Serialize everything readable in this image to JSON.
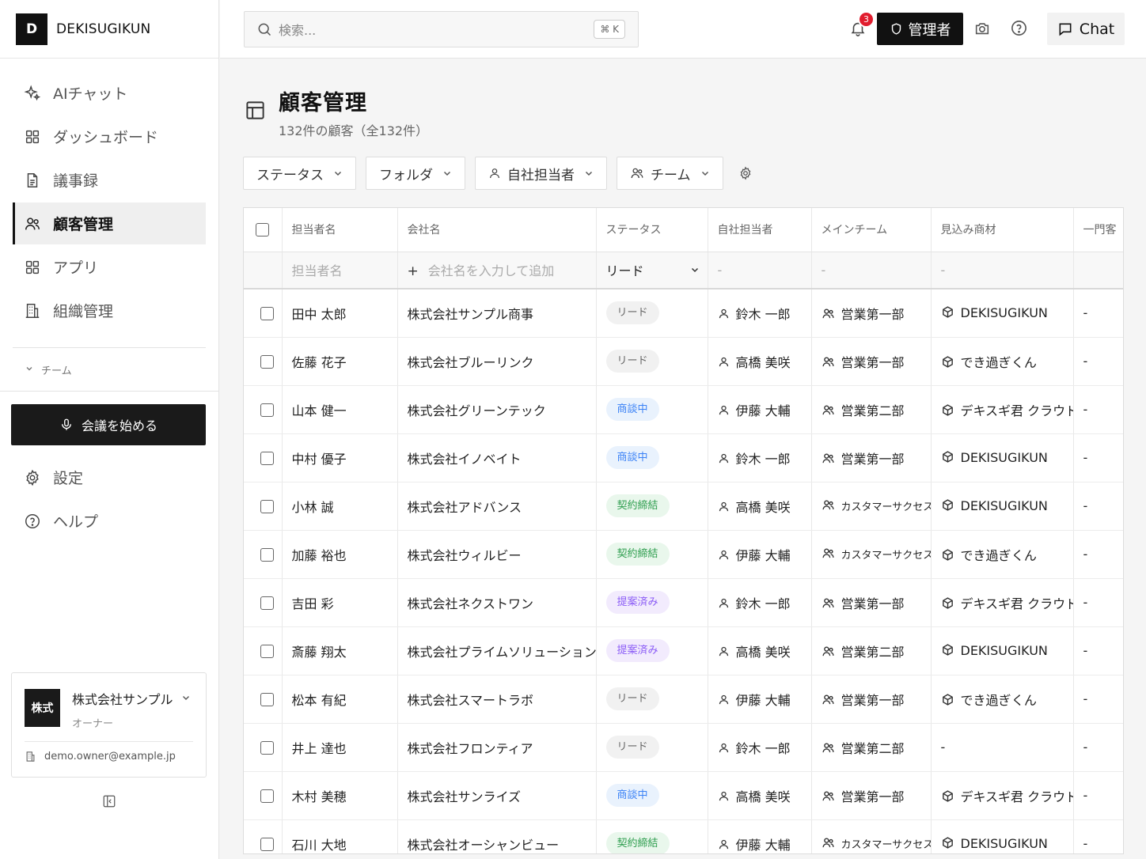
{
  "brand": {
    "logo_letter": "D",
    "name": "DEKISUGIKUN"
  },
  "nav": [
    {
      "label": "AIチャット",
      "icon": "sparkles-icon",
      "active": false
    },
    {
      "label": "ダッシュボード",
      "icon": "grid-icon",
      "active": false
    },
    {
      "label": "議事録",
      "icon": "document-icon",
      "active": false
    },
    {
      "label": "顧客管理",
      "icon": "users-icon",
      "active": true
    },
    {
      "label": "アプリ",
      "icon": "grid-icon",
      "active": false
    },
    {
      "label": "組織管理",
      "icon": "building-icon",
      "active": false
    }
  ],
  "team_section": {
    "label": "チーム"
  },
  "meeting_button": {
    "label": "会議を始める"
  },
  "nav_bottom": [
    {
      "label": "設定",
      "icon": "gear-icon"
    },
    {
      "label": "ヘルプ",
      "icon": "help-circle-icon"
    }
  ],
  "org": {
    "logo_text": "株式",
    "name": "株式会社サンプル",
    "role": "オーナー",
    "email": "demo.owner@example.jp"
  },
  "topbar": {
    "search_placeholder": "検索...",
    "shortcut": "⌘ K",
    "notification_count": "3",
    "admin_label": "管理者",
    "chat_label": "Chat"
  },
  "page": {
    "title": "顧客管理",
    "subtitle": "132件の顧客（全132件）"
  },
  "filters": [
    {
      "label": "ステータス",
      "icon": ""
    },
    {
      "label": "フォルダ",
      "icon": ""
    },
    {
      "label": "自社担当者",
      "icon": "user-icon"
    },
    {
      "label": "チーム",
      "icon": "users-icon"
    }
  ],
  "table": {
    "columns": [
      "担当者名",
      "会社名",
      "ステータス",
      "自社担当者",
      "メインチーム",
      "見込み商材",
      "一門客"
    ],
    "add_row": {
      "name_placeholder": "担当者名",
      "company_placeholder": "会社名を入力して追加",
      "status_value": "リード",
      "owner": "-",
      "team": "-",
      "product": "-"
    },
    "rows": [
      {
        "name": "田中 太郎",
        "company": "株式会社サンプル商事",
        "status": "リード",
        "status_type": "lead",
        "owner": "鈴木 一郎",
        "team": "営業第一部",
        "product": "DEKISUGIKUN",
        "extra": "-"
      },
      {
        "name": "佐藤 花子",
        "company": "株式会社ブルーリンク",
        "status": "リード",
        "status_type": "lead",
        "owner": "高橋 美咲",
        "team": "営業第一部",
        "product": "でき過ぎくん",
        "extra": "-"
      },
      {
        "name": "山本 健一",
        "company": "株式会社グリーンテック",
        "status": "商談中",
        "status_type": "nego",
        "owner": "伊藤 大輔",
        "team": "営業第二部",
        "product": "デキスギ君 クラウド",
        "extra": "-"
      },
      {
        "name": "中村 優子",
        "company": "株式会社イノベイト",
        "status": "商談中",
        "status_type": "nego",
        "owner": "鈴木 一郎",
        "team": "営業第一部",
        "product": "DEKISUGIKUN",
        "extra": "-"
      },
      {
        "name": "小林 誠",
        "company": "株式会社アドバンス",
        "status": "契約締結",
        "status_type": "won",
        "owner": "高橋 美咲",
        "team": "カスタマーサクセス",
        "product": "DEKISUGIKUN",
        "extra": "-"
      },
      {
        "name": "加藤 裕也",
        "company": "株式会社ウィルビー",
        "status": "契約締結",
        "status_type": "won",
        "owner": "伊藤 大輔",
        "team": "カスタマーサクセス",
        "product": "でき過ぎくん",
        "extra": "-"
      },
      {
        "name": "吉田 彩",
        "company": "株式会社ネクストワン",
        "status": "提案済み",
        "status_type": "prop",
        "owner": "鈴木 一郎",
        "team": "営業第一部",
        "product": "デキスギ君 クラウド",
        "extra": "-"
      },
      {
        "name": "斎藤 翔太",
        "company": "株式会社プライムソリューション",
        "status": "提案済み",
        "status_type": "prop",
        "owner": "高橋 美咲",
        "team": "営業第二部",
        "product": "DEKISUGIKUN",
        "extra": "-"
      },
      {
        "name": "松本 有紀",
        "company": "株式会社スマートラボ",
        "status": "リード",
        "status_type": "lead",
        "owner": "伊藤 大輔",
        "team": "営業第一部",
        "product": "でき過ぎくん",
        "extra": "-"
      },
      {
        "name": "井上 達也",
        "company": "株式会社フロンティア",
        "status": "リード",
        "status_type": "lead",
        "owner": "鈴木 一郎",
        "team": "営業第二部",
        "product": "-",
        "extra": "-"
      },
      {
        "name": "木村 美穂",
        "company": "株式会社サンライズ",
        "status": "商談中",
        "status_type": "nego",
        "owner": "高橋 美咲",
        "team": "営業第一部",
        "product": "デキスギ君 クラウド",
        "extra": "-"
      },
      {
        "name": "石川 大地",
        "company": "株式会社オーシャンビュー",
        "status": "契約締結",
        "status_type": "won",
        "owner": "伊藤 大輔",
        "team": "カスタマーサクセス",
        "product": "DEKISUGIKUN",
        "extra": "-"
      }
    ]
  },
  "colors": {
    "accent": "#111111",
    "badge": "#e11d2e",
    "nego": "#3b82f6",
    "won": "#2f9e4f",
    "prop": "#8b5cf6"
  }
}
